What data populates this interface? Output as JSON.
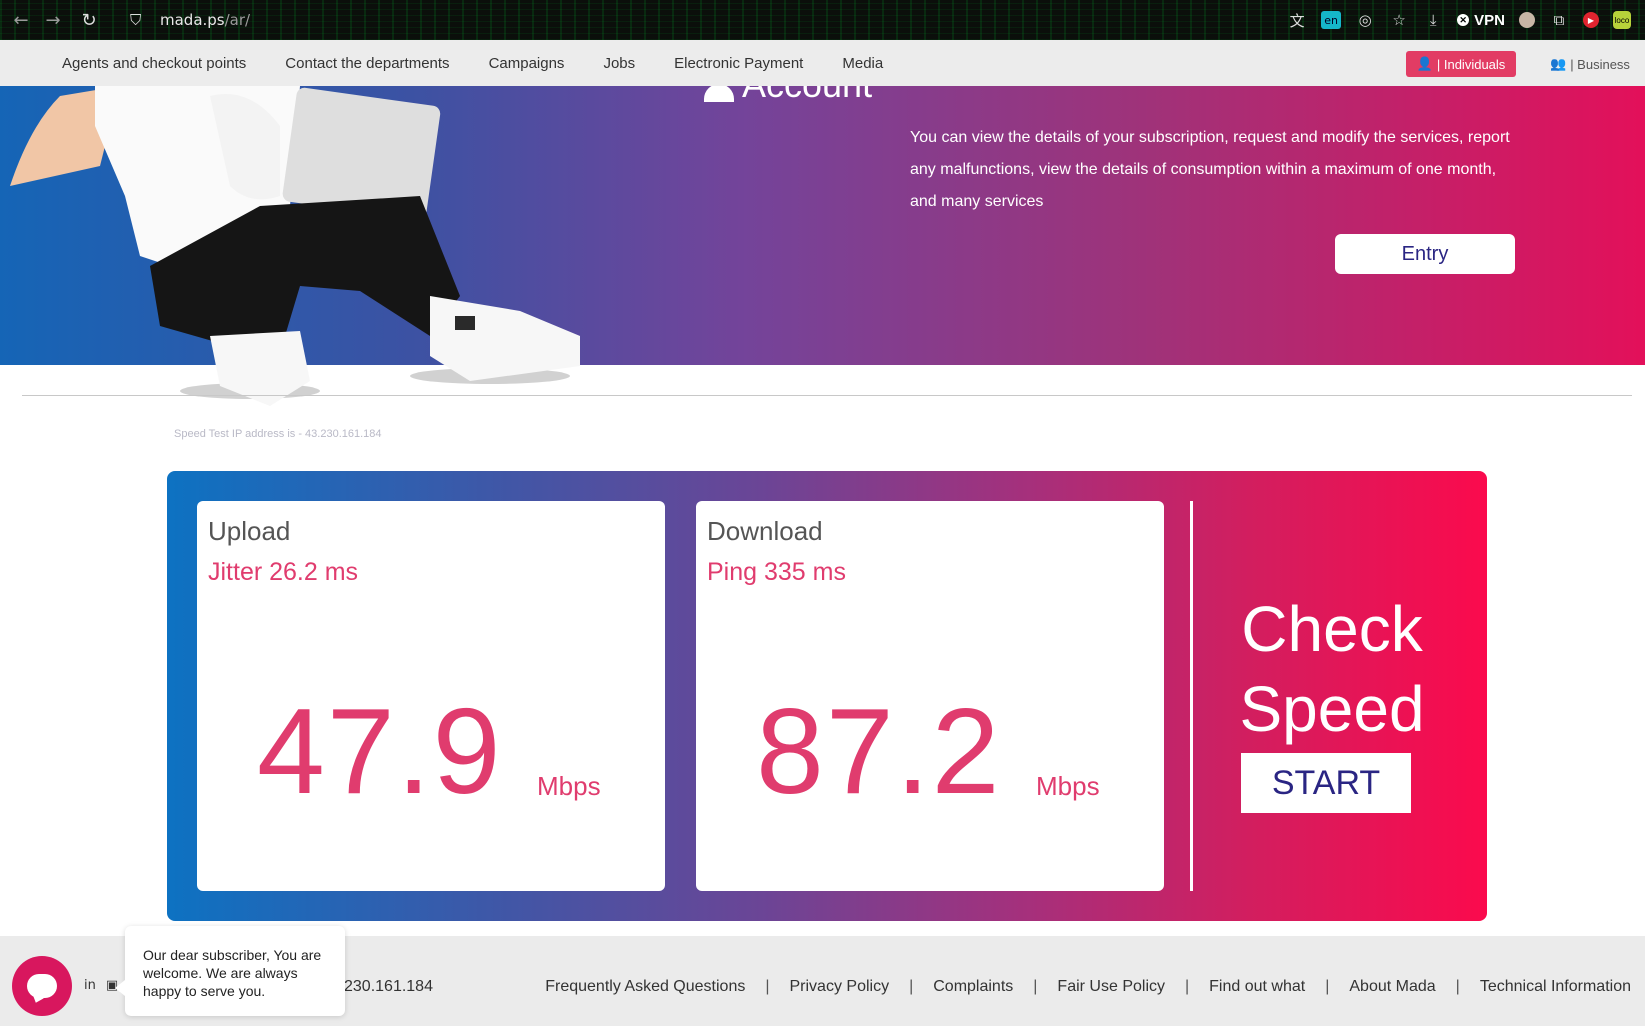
{
  "browser": {
    "url_host": "mada.ps",
    "url_path": "/ar/",
    "translate_badge": "en",
    "vpn_label": "VPN",
    "ext_badge": "loco"
  },
  "nav": {
    "links": [
      "Agents and checkout points",
      "Contact the departments",
      "Campaigns",
      "Jobs",
      "Electronic Payment",
      "Media"
    ],
    "individuals_label": "| Individuals",
    "business_label": "| Business"
  },
  "hero": {
    "title": "Account",
    "description": "You can view the details of your subscription, request and modify the services, report any malfunctions, view the details of consumption within a maximum of one month, and many services",
    "entry_label": "Entry"
  },
  "speedtest": {
    "ip_text": "Speed Test IP address is - 43.230.161.184",
    "upload": {
      "label": "Upload",
      "sub": "Jitter 26.2 ms",
      "value": "47.9",
      "unit": "Mbps"
    },
    "download": {
      "label": "Download",
      "sub": "Ping 335 ms",
      "value": "87.2",
      "unit": "Mbps"
    },
    "check_line1": "Check",
    "check_line2": "Speed",
    "start_label": "START"
  },
  "footer": {
    "ip_fragment": "230.161.184",
    "links": [
      "Frequently Asked Questions",
      "Privacy Policy",
      "Complaints",
      "Fair Use Policy",
      "Find out what",
      "About Mada",
      "Technical Information"
    ]
  },
  "chat": {
    "message": "Our dear subscriber, You are welcome. We are always happy to serve you."
  },
  "colors": {
    "accent_pink": "#e03c6e",
    "brand_navy": "#2a2583",
    "gradient_start": "#0d72c2",
    "gradient_end": "#fb0a4d"
  }
}
